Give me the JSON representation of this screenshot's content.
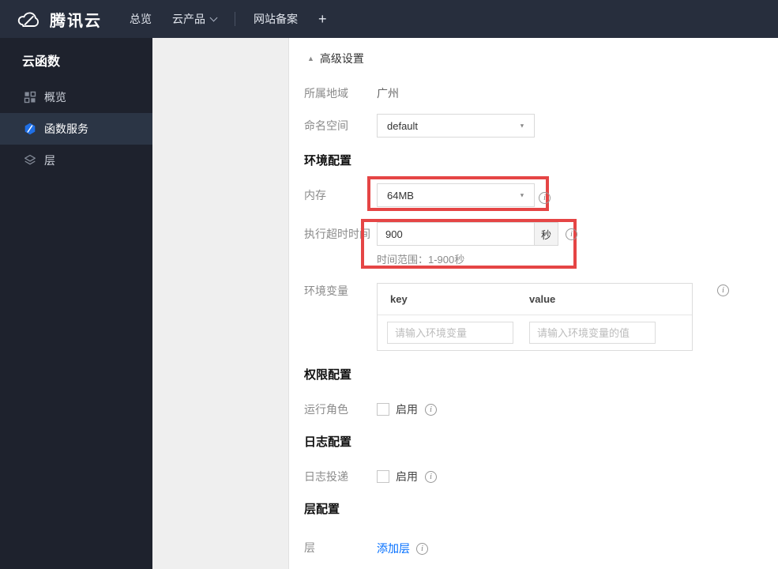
{
  "topbar": {
    "brand": "腾讯云",
    "nav": [
      {
        "label": "总览",
        "has_caret": false
      },
      {
        "label": "云产品",
        "has_caret": true
      },
      {
        "label": "网站备案",
        "has_caret": false
      },
      {
        "label": "+",
        "has_caret": false
      }
    ]
  },
  "sidebar": {
    "title": "云函数",
    "items": [
      {
        "label": "概览",
        "icon": "overview-grid-icon",
        "selected": false
      },
      {
        "label": "函数服务",
        "icon": "function-service-icon",
        "selected": true
      },
      {
        "label": "层",
        "icon": "layers-icon",
        "selected": false
      }
    ]
  },
  "form": {
    "advanced_toggle": "高级设置",
    "region": {
      "label": "所属地域",
      "value": "广州"
    },
    "namespace": {
      "label": "命名空间",
      "value": "default"
    },
    "section_env": "环境配置",
    "memory": {
      "label": "内存",
      "value": "64MB"
    },
    "timeout": {
      "label": "执行超时时间",
      "value": "900",
      "unit": "秒",
      "hint": "时间范围：1-900秒"
    },
    "env_vars": {
      "label": "环境变量",
      "key_header": "key",
      "value_header": "value",
      "key_placeholder": "请输入环境变量",
      "value_placeholder": "请输入环境变量的值"
    },
    "section_perm": "权限配置",
    "run_role": {
      "label": "运行角色",
      "enable_label": "启用"
    },
    "section_log": "日志配置",
    "log_delivery": {
      "label": "日志投递",
      "enable_label": "启用"
    },
    "section_layer": "层配置",
    "layer": {
      "label": "层",
      "add_label": "添加层"
    }
  },
  "icons": {
    "collapse_arrow": "▲",
    "dropdown_caret": "▼",
    "info": "i"
  },
  "colors": {
    "topbar_bg": "#272e3d",
    "sidebar_bg": "#1e222d",
    "sidebar_selected_bg": "#2b3545",
    "panel_gray": "#efefef",
    "annotation_red": "#e54545",
    "link_blue": "#006eff",
    "function_icon_blue": "#1f6fe5"
  }
}
